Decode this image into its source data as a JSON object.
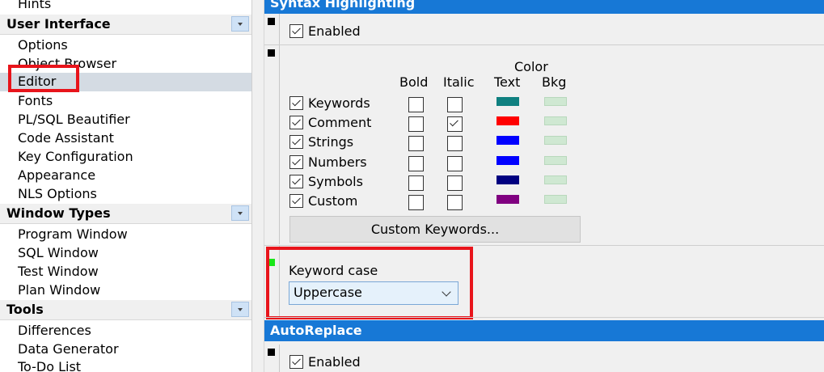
{
  "tree": {
    "hints": "Hints",
    "ui_category": "User Interface",
    "ui_items": [
      "Options",
      "Object Browser",
      "Editor",
      "Fonts",
      "PL/SQL Beautifier",
      "Code Assistant",
      "Key Configuration",
      "Appearance",
      "NLS Options"
    ],
    "wt_category": "Window Types",
    "wt_items": [
      "Program Window",
      "SQL Window",
      "Test Window",
      "Plan Window"
    ],
    "tools_category": "Tools",
    "tools_items": [
      "Differences",
      "Data Generator",
      "To-Do List"
    ],
    "selected": "Editor"
  },
  "syntax": {
    "header": "Syntax Highlighting",
    "enabled_label": "Enabled",
    "enabled": true,
    "col_color": "Color",
    "col_bold": "Bold",
    "col_italic": "Italic",
    "col_text": "Text",
    "col_bkg": "Bkg",
    "rows": [
      {
        "label": "Keywords",
        "checked": true,
        "bold": false,
        "italic": false,
        "text_color": "#0f8080",
        "bkg_color": "#cfe8d2"
      },
      {
        "label": "Comment",
        "checked": true,
        "bold": false,
        "italic": true,
        "text_color": "#ff0000",
        "bkg_color": "#cfe8d2"
      },
      {
        "label": "Strings",
        "checked": true,
        "bold": false,
        "italic": false,
        "text_color": "#0000ff",
        "bkg_color": "#cfe8d2"
      },
      {
        "label": "Numbers",
        "checked": true,
        "bold": false,
        "italic": false,
        "text_color": "#0000ff",
        "bkg_color": "#cfe8d2"
      },
      {
        "label": "Symbols",
        "checked": true,
        "bold": false,
        "italic": false,
        "text_color": "#000080",
        "bkg_color": "#cfe8d2"
      },
      {
        "label": "Custom",
        "checked": true,
        "bold": false,
        "italic": false,
        "text_color": "#800080",
        "bkg_color": "#cfe8d2"
      }
    ],
    "custom_keywords_button": "Custom Keywords...",
    "keyword_case_label": "Keyword case",
    "keyword_case_value": "Uppercase"
  },
  "autoreplace": {
    "header": "AutoReplace",
    "enabled_label": "Enabled",
    "enabled": true
  },
  "colors": {
    "header_bg": "#1778d6",
    "highlight_box": "#e8141b",
    "selected_row": "#d4dbe3"
  }
}
